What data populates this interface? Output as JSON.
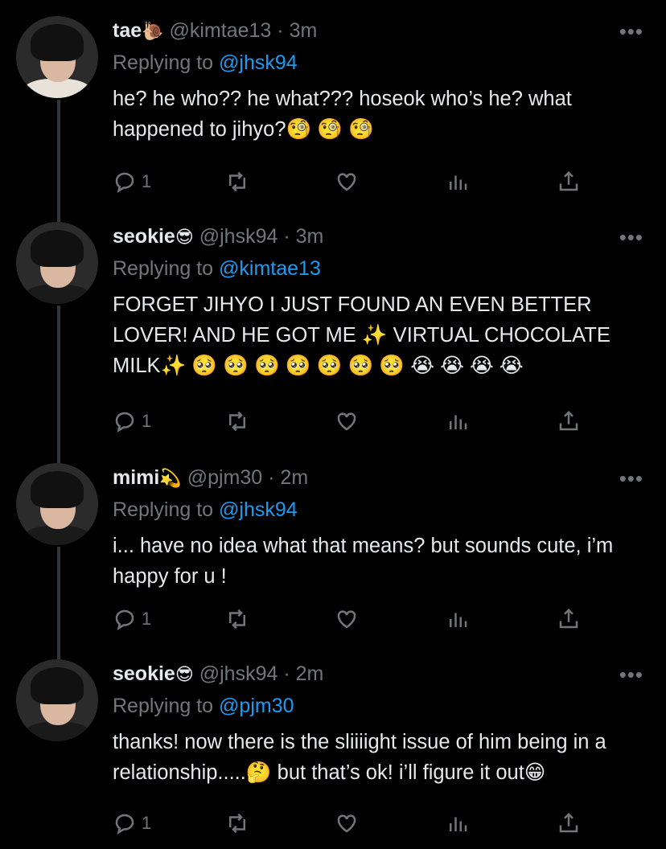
{
  "tweets": [
    {
      "name": "tae",
      "name_emoji": "🐌",
      "handle": "@kimtae13",
      "sep": "·",
      "time": "3m",
      "replying_prefix": "Replying to",
      "replying_to": "@jhsk94",
      "text": "he? he who?? he what??? hoseok who’s he? what happened to jihyo?🧐 🧐 🧐",
      "reply_count": "1"
    },
    {
      "name": "seokie",
      "name_emoji": "😎",
      "handle": "@jhsk94",
      "sep": "·",
      "time": "3m",
      "replying_prefix": "Replying to",
      "replying_to": "@kimtae13",
      "text": "FORGET JIHYO I JUST FOUND AN EVEN BETTER LOVER! AND HE GOT ME ✨ VIRTUAL CHOCOLATE MILK✨ 🥺 🥺 🥺 🥺 🥺 🥺 🥺 😭 😭 😭 😭",
      "reply_count": "1"
    },
    {
      "name": "mimi",
      "name_emoji": "💫",
      "handle": "@pjm30",
      "sep": "·",
      "time": "2m",
      "replying_prefix": "Replying to",
      "replying_to": "@jhsk94",
      "text": "i... have no idea what that means? but sounds cute, i’m happy for u !",
      "reply_count": "1"
    },
    {
      "name": "seokie",
      "name_emoji": "😎",
      "handle": "@jhsk94",
      "sep": "·",
      "time": "2m",
      "replying_prefix": "Replying to",
      "replying_to": "@pjm30",
      "text": "thanks! now there is the sliiiight issue of him being in a relationship.....🤔  but that’s ok! i’ll figure it out😁",
      "reply_count": "1"
    }
  ],
  "icons": {
    "more": "more-icon",
    "reply": "reply-icon",
    "retweet": "retweet-icon",
    "like": "heart-icon",
    "analytics": "analytics-icon",
    "share": "share-icon"
  },
  "more_glyph": "•••",
  "colors": {
    "background": "#000000",
    "text": "#e7e9ea",
    "muted": "#71767b",
    "link": "#1d9bf0",
    "thread_line": "#333639"
  }
}
